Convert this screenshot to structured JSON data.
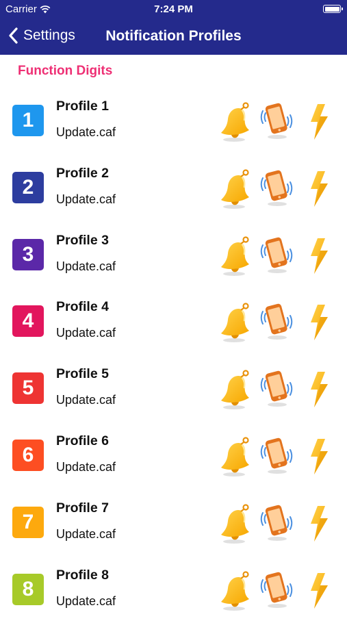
{
  "status_bar": {
    "carrier": "Carrier",
    "time": "7:24 PM",
    "wifi_icon": "wifi-icon",
    "battery_icon": "battery-icon"
  },
  "nav": {
    "back_label": "Settings",
    "back_icon": "chevron-left-icon",
    "title": "Notification Profiles"
  },
  "section": {
    "title": "Function Digits"
  },
  "colors": {
    "header_bg": "#242a8c",
    "section_title": "#ee2f74"
  },
  "profiles": [
    {
      "digit": "1",
      "name": "Profile 1",
      "sound": "Update.caf",
      "color": "#1e97ee"
    },
    {
      "digit": "2",
      "name": "Profile 2",
      "sound": "Update.caf",
      "color": "#2d3d9f"
    },
    {
      "digit": "3",
      "name": "Profile 3",
      "sound": "Update.caf",
      "color": "#5b28a8"
    },
    {
      "digit": "4",
      "name": "Profile 4",
      "sound": "Update.caf",
      "color": "#e2165d"
    },
    {
      "digit": "5",
      "name": "Profile 5",
      "sound": "Update.caf",
      "color": "#ee3433"
    },
    {
      "digit": "6",
      "name": "Profile 6",
      "sound": "Update.caf",
      "color": "#fd4e22"
    },
    {
      "digit": "7",
      "name": "Profile 7",
      "sound": "Update.caf",
      "color": "#fda90e"
    },
    {
      "digit": "8",
      "name": "Profile 8",
      "sound": "Update.caf",
      "color": "#a7ca29"
    }
  ],
  "row_icons": [
    "bell-icon",
    "vibrating-phone-icon",
    "lightning-bolt-icon"
  ]
}
